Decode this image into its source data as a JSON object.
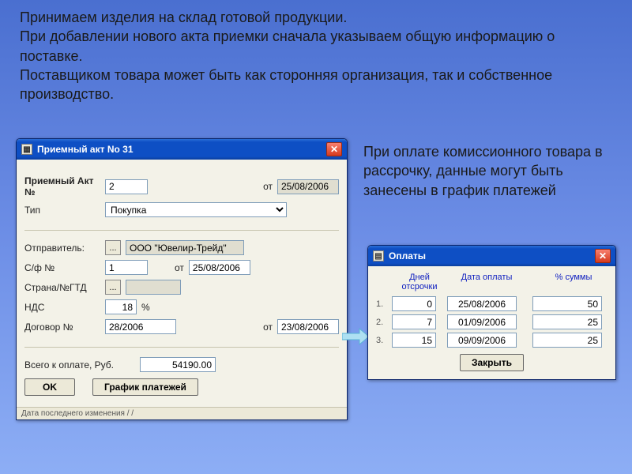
{
  "slide": {
    "p1": "Принимаем изделия на склад готовой продукции.\nПри добавлении нового акта приемки сначала указываем общую информацию о поставке.\nПоставщиком товара может быть как сторонняя  организация, так и собственное производство.",
    "p2": "При оплате комиссионного товара в рассрочку, данные могут быть занесены в график платежей"
  },
  "act": {
    "title": "Приемный акт No 31",
    "lbl_no": "Приемный Акт №",
    "no": "2",
    "lbl_from": "от",
    "date": "25/08/2006",
    "lbl_type": "Тип",
    "type_value": "Покупка",
    "lbl_sender": "Отправитель:",
    "sender": "ООО \"Ювелир-Трейд\"",
    "lbl_sf": "С/ф №",
    "sf_no": "1",
    "sf_date": "25/08/2006",
    "lbl_country": "Страна/№ГТД",
    "country_value": "",
    "lbl_vat": "НДС",
    "vat": "18",
    "vat_pct": "%",
    "lbl_contract": "Договор №",
    "contract_no": "28/2006",
    "contract_date": "23/08/2006",
    "lbl_total": "Всего к оплате, Руб.",
    "total": "54190.00",
    "btn_ok": "OK",
    "btn_schedule": "График платежей",
    "status": "Дата последнего изменения         /  /"
  },
  "pay": {
    "title": "Оплаты",
    "h_days": "Дней\nотсрочки",
    "h_date": "Дата оплаты",
    "h_pct": "% суммы",
    "rows": [
      {
        "idx": "1.",
        "days": "0",
        "date": "25/08/2006",
        "pct": "50"
      },
      {
        "idx": "2.",
        "days": "7",
        "date": "01/09/2006",
        "pct": "25"
      },
      {
        "idx": "3.",
        "days": "15",
        "date": "09/09/2006",
        "pct": "25"
      }
    ],
    "btn_close": "Закрыть"
  }
}
